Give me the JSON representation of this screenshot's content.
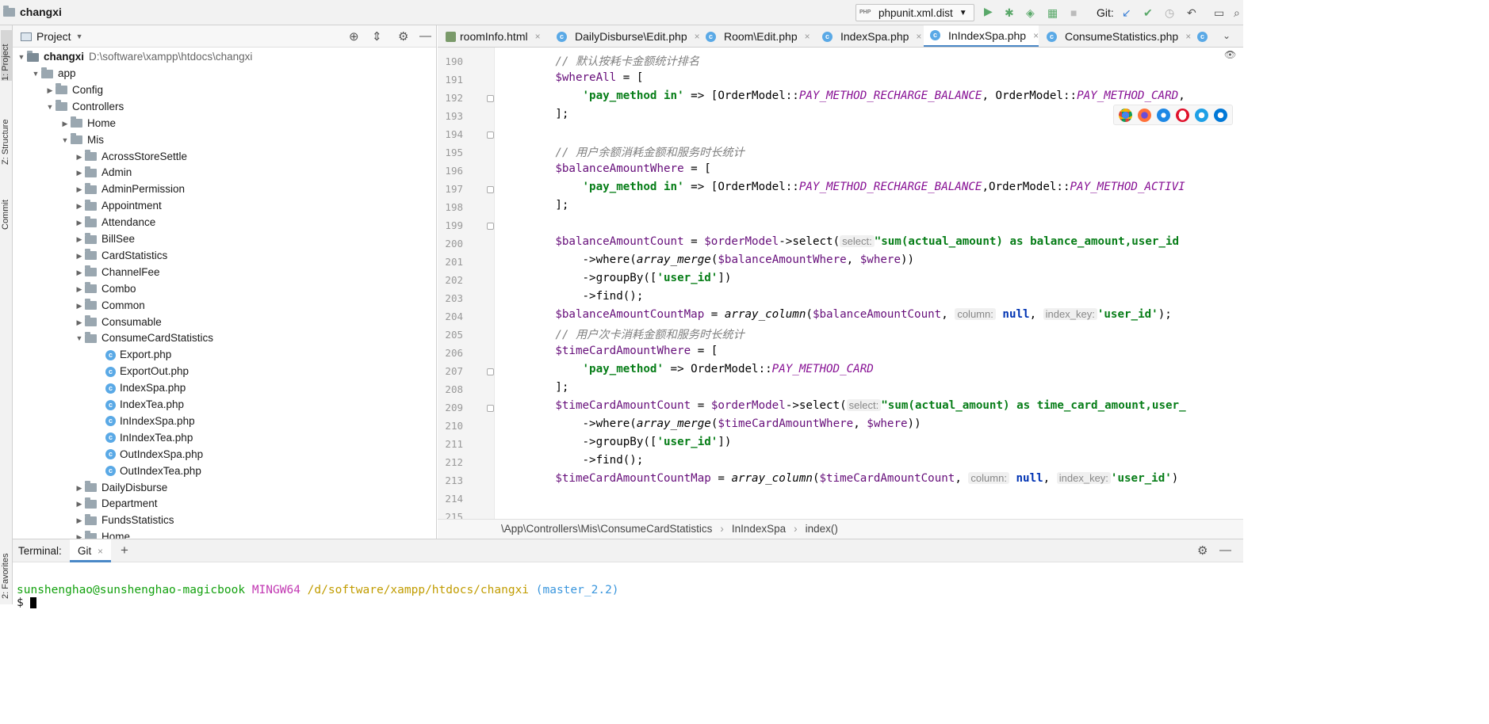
{
  "title_bar": {
    "project_name": "changxi",
    "run_config": "phpunit.xml.dist",
    "vcs_label": "Git:"
  },
  "left_toolbar": {
    "tabs": [
      "1: Project",
      "Z: Structure",
      "Commit"
    ],
    "favorites": "2: Favorites"
  },
  "project_panel": {
    "title": "Project",
    "root_name": "changxi",
    "root_path": "D:\\software\\xampp\\htdocs\\changxi",
    "tree": [
      {
        "label": "app",
        "level": 1,
        "kind": "folder",
        "expanded": true
      },
      {
        "label": "Config",
        "level": 2,
        "kind": "folder",
        "expanded": false
      },
      {
        "label": "Controllers",
        "level": 2,
        "kind": "folder",
        "expanded": true
      },
      {
        "label": "Home",
        "level": 3,
        "kind": "folder",
        "expanded": false
      },
      {
        "label": "Mis",
        "level": 3,
        "kind": "folder",
        "expanded": true
      },
      {
        "label": "AcrossStoreSettle",
        "level": 4,
        "kind": "folder",
        "expanded": false
      },
      {
        "label": "Admin",
        "level": 4,
        "kind": "folder",
        "expanded": false
      },
      {
        "label": "AdminPermission",
        "level": 4,
        "kind": "folder",
        "expanded": false
      },
      {
        "label": "Appointment",
        "level": 4,
        "kind": "folder",
        "expanded": false
      },
      {
        "label": "Attendance",
        "level": 4,
        "kind": "folder",
        "expanded": false
      },
      {
        "label": "BillSee",
        "level": 4,
        "kind": "folder",
        "expanded": false
      },
      {
        "label": "CardStatistics",
        "level": 4,
        "kind": "folder",
        "expanded": false
      },
      {
        "label": "ChannelFee",
        "level": 4,
        "kind": "folder",
        "expanded": false
      },
      {
        "label": "Combo",
        "level": 4,
        "kind": "folder",
        "expanded": false
      },
      {
        "label": "Common",
        "level": 4,
        "kind": "folder",
        "expanded": false
      },
      {
        "label": "Consumable",
        "level": 4,
        "kind": "folder",
        "expanded": false
      },
      {
        "label": "ConsumeCardStatistics",
        "level": 4,
        "kind": "folder",
        "expanded": true
      },
      {
        "label": "Export.php",
        "level": 5,
        "kind": "file"
      },
      {
        "label": "ExportOut.php",
        "level": 5,
        "kind": "file"
      },
      {
        "label": "IndexSpa.php",
        "level": 5,
        "kind": "file"
      },
      {
        "label": "IndexTea.php",
        "level": 5,
        "kind": "file"
      },
      {
        "label": "InIndexSpa.php",
        "level": 5,
        "kind": "file"
      },
      {
        "label": "InIndexTea.php",
        "level": 5,
        "kind": "file"
      },
      {
        "label": "OutIndexSpa.php",
        "level": 5,
        "kind": "file"
      },
      {
        "label": "OutIndexTea.php",
        "level": 5,
        "kind": "file"
      },
      {
        "label": "DailyDisburse",
        "level": 4,
        "kind": "folder",
        "expanded": false
      },
      {
        "label": "Department",
        "level": 4,
        "kind": "folder",
        "expanded": false
      },
      {
        "label": "FundsStatistics",
        "level": 4,
        "kind": "folder",
        "expanded": false
      },
      {
        "label": "Home",
        "level": 4,
        "kind": "folder",
        "expanded": false
      }
    ]
  },
  "editor_tabs": [
    {
      "label": "roomInfo.html",
      "icon": "html",
      "active": false
    },
    {
      "label": "DailyDisburse\\Edit.php",
      "icon": "php-class",
      "active": false
    },
    {
      "label": "Room\\Edit.php",
      "icon": "php-class",
      "active": false
    },
    {
      "label": "IndexSpa.php",
      "icon": "php-class",
      "active": false
    },
    {
      "label": "InIndexSpa.php",
      "icon": "php-class",
      "active": true
    },
    {
      "label": "ConsumeStatistics.php",
      "icon": "php-class",
      "active": false
    }
  ],
  "code": {
    "line_numbers": [
      "190",
      "191",
      "192",
      "193",
      "194",
      "195",
      "196",
      "197",
      "198",
      "199",
      "200",
      "201",
      "202",
      "203",
      "204",
      "205",
      "206",
      "207",
      "208",
      "209",
      "210",
      "211",
      "212",
      "213",
      "214",
      "215"
    ],
    "l190": "];",
    "l191": "// 默认按耗卡金额统计排名",
    "l192a": "$whereAll",
    "l192b": " = [",
    "l193a": "'pay_method in'",
    "l193b": " => [OrderModel::",
    "l193c": "PAY_METHOD_RECHARGE_BALANCE",
    "l193d": ", OrderModel::",
    "l193e": "PAY_METHOD_CARD",
    "l193f": ",",
    "l194": "];",
    "l196": "// 用户余额消耗金额和服务时长统计",
    "l197a": "$balanceAmountWhere",
    "l197b": " = [",
    "l198a": "'pay_method in'",
    "l198b": " => [OrderModel::",
    "l198c": "PAY_METHOD_RECHARGE_BALANCE",
    "l198d": ",OrderModel::",
    "l198e": "PAY_METHOD_ACTIVI",
    "l199": "];",
    "l201a": "$balanceAmountCount",
    "l201b": " = ",
    "l201c": "$orderModel",
    "l201d": "->select(",
    "l201h": "select:",
    "l201e": "\"sum(actual_amount) as balance_amount,user_id",
    "l202a": "->where(",
    "l202b": "array_merge",
    "l202c": "(",
    "l202d": "$balanceAmountWhere",
    "l202e": ", ",
    "l202f": "$where",
    "l202g": "))",
    "l203a": "->groupBy([",
    "l203b": "'user_id'",
    "l203c": "])",
    "l204": "->find();",
    "l205a": "$balanceAmountCountMap",
    "l205b": " = ",
    "l205c": "array_column",
    "l205d": "(",
    "l205e": "$balanceAmountCount",
    "l205f": ",",
    "l205h1": "column:",
    "l205g": "null",
    "l205i": ",",
    "l205h2": "index_key:",
    "l205j": "'user_id'",
    "l205k": ");",
    "l206": "// 用户次卡消耗金额和服务时长统计",
    "l207a": "$timeCardAmountWhere",
    "l207b": " = [",
    "l208a": "'pay_method'",
    "l208b": " => OrderModel::",
    "l208c": "PAY_METHOD_CARD",
    "l209": "];",
    "l210a": "$timeCardAmountCount",
    "l210b": " = ",
    "l210c": "$orderModel",
    "l210d": "->select(",
    "l210h": "select:",
    "l210e": "\"sum(actual_amount) as time_card_amount,user_",
    "l211a": "->where(",
    "l211b": "array_merge",
    "l211c": "(",
    "l211d": "$timeCardAmountWhere",
    "l211e": ", ",
    "l211f": "$where",
    "l211g": "))",
    "l212a": "->groupBy([",
    "l212b": "'user_id'",
    "l212c": "])",
    "l213": "->find();",
    "l214a": "$timeCardAmountCountMap",
    "l214b": " = ",
    "l214c": "array_column",
    "l214d": "(",
    "l214e": "$timeCardAmountCount",
    "l214f": ",",
    "l214h1": "column:",
    "l214g": "null",
    "l214i": ",",
    "l214h2": "index_key:",
    "l214j": "'user_id'",
    "l214k": ")"
  },
  "breadcrumb": [
    "\\App\\Controllers\\Mis\\ConsumeCardStatistics",
    "InIndexSpa",
    "index()"
  ],
  "terminal": {
    "label": "Terminal:",
    "tab": "Git",
    "user_host": "sunshenghao@sunshenghao-magicbook",
    "shell": "MINGW64",
    "cwd": "/d/software/xampp/htdocs/changxi",
    "branch": "(master_2.2)",
    "prompt": "$"
  },
  "colors": {
    "accent": "#4a88c7",
    "run_green": "#59a869",
    "string_green": "#067d17",
    "variable_purple": "#660e7a",
    "terminal_green": "#13a10e",
    "terminal_magenta": "#c239b3",
    "terminal_yellow": "#c19c00",
    "terminal_cyan": "#3a96dd"
  }
}
